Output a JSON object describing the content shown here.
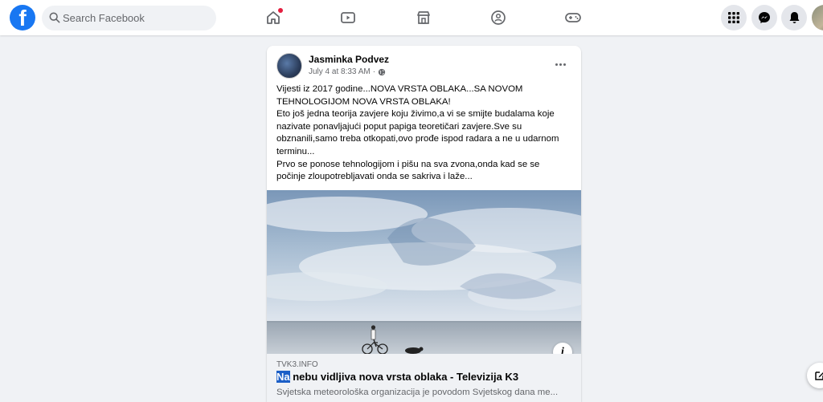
{
  "header": {
    "logo_letter": "f",
    "search": {
      "placeholder": "Search Facebook",
      "value": ""
    },
    "nav": [
      {
        "name": "home",
        "icon": "home-icon",
        "has_notification": true
      },
      {
        "name": "watch",
        "icon": "video-icon"
      },
      {
        "name": "marketplace",
        "icon": "marketplace-icon"
      },
      {
        "name": "groups",
        "icon": "groups-icon"
      },
      {
        "name": "gaming",
        "icon": "gaming-icon"
      }
    ],
    "right_buttons": [
      "menu-grid-icon",
      "messenger-icon",
      "bell-icon"
    ],
    "accent": "#1877f2",
    "notification_color": "#e41e3f"
  },
  "post": {
    "author": "Jasminka Podvez",
    "timestamp": "July 4 at 8:33 AM",
    "separator": "·",
    "privacy_icon": "globe-icon",
    "text_lines": [
      "Vijesti iz 2017 godine...NOVA VRSTA OBLAKA...SA NOVOM",
      "TEHNOLOGIJOM NOVA VRSTA OBLAKA!",
      "Eto još jedna teorija zavjere koju živimo,a vi se smijte budalama koje",
      "nazivate ponavljajući poput papiga teoretičari zavjere.Sve su",
      "obznanili,samo treba otkopati,ovo prođe ispod radara a ne u udarnom",
      "terminu...",
      "Prvo se ponose tehnologijom i pišu na sva zvona,onda kad se se",
      "počinje zloupotrebljavati onda se sakriva i laže..."
    ],
    "link": {
      "domain": "TVK3.INFO",
      "title_highlight": "Na",
      "title_rest": " nebu vidljiva nova vrsta oblaka - Televizija K3",
      "description": "Svjetska meteorološka organizacija je povodom Svjetskog dana me...",
      "image_alt": "sky-clouds-cyclist-beach"
    }
  }
}
